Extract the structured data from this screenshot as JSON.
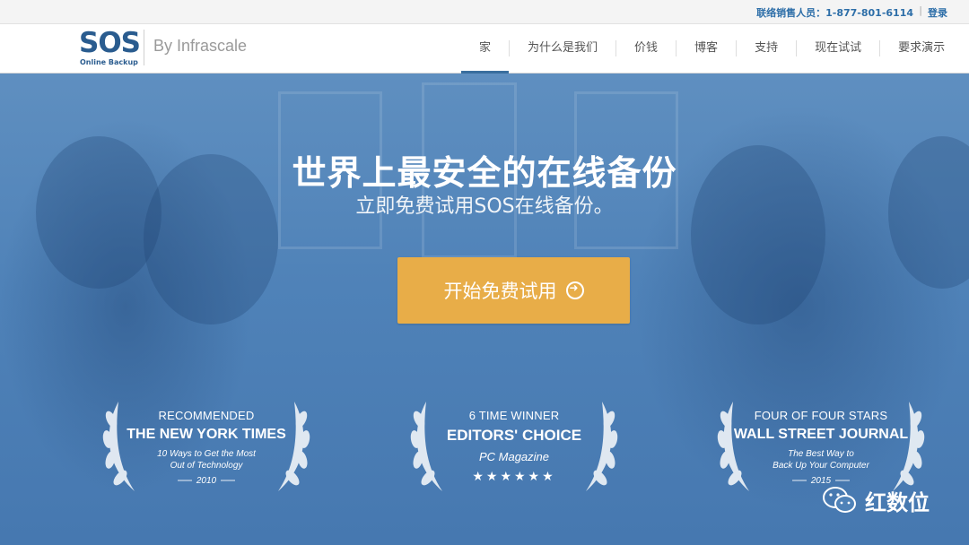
{
  "topbar": {
    "sales_contact": "联络销售人员：1-877-801-6114",
    "separator": "|",
    "login": "登录"
  },
  "header": {
    "logo_main": "SOS",
    "logo_sub": "Online Backup",
    "byline": "By Infrascale",
    "nav": [
      "家",
      "为什么是我们",
      "价钱",
      "博客",
      "支持",
      "现在试试",
      "要求演示"
    ],
    "active_nav": "家"
  },
  "hero": {
    "headline": "世界上最安全的在线备份",
    "subline": "立即免费试用SOS在线备份。",
    "cta_label": "开始免费试用",
    "cta_color": "#e8ad48",
    "overlay_color": "#4f82b8"
  },
  "awards": [
    {
      "line1": "RECOMMENDED",
      "line2": "THE NEW YORK TIMES",
      "line3a": "10 Ways to Get the Most",
      "line3b": "Out of Technology",
      "year": "2010"
    },
    {
      "line1": "6 TIME WINNER",
      "line2": "EDITORS' CHOICE",
      "line3": "PC Magazine",
      "stars": "★★★★★★"
    },
    {
      "line1": "FOUR OF FOUR STARS",
      "line2": "WALL STREET JOURNAL",
      "line3a": "The Best Way to",
      "line3b": "Back Up Your Computer",
      "year": "2015"
    }
  ],
  "watermark": {
    "icon": "wechat-icon",
    "text": "红数位"
  }
}
